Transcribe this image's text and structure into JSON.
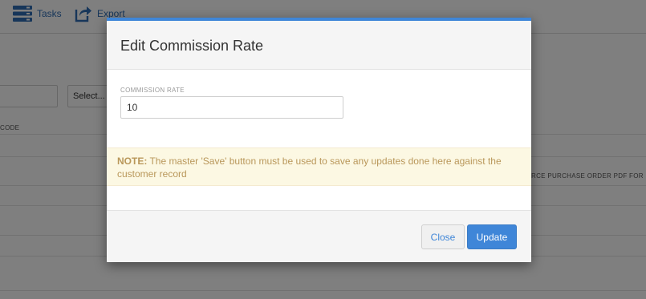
{
  "toolbar": {
    "tasks_label": "Tasks",
    "export_label": "Export"
  },
  "background": {
    "select_placeholder": "Select...",
    "column_header": "CODE",
    "right_header": "RCE PURCHASE ORDER PDF FOR"
  },
  "modal": {
    "title": "Edit Commission Rate",
    "field_label": "COMMISSION RATE",
    "field_value": "10",
    "note_strong": "NOTE:",
    "note_text": " The master 'Save' button must be used to save any updates done here against the customer record",
    "close_label": "Close",
    "update_label": "Update"
  },
  "colors": {
    "accent": "#3f86d8",
    "note_bg": "#fcf8e3",
    "note_text": "#b9975a"
  }
}
